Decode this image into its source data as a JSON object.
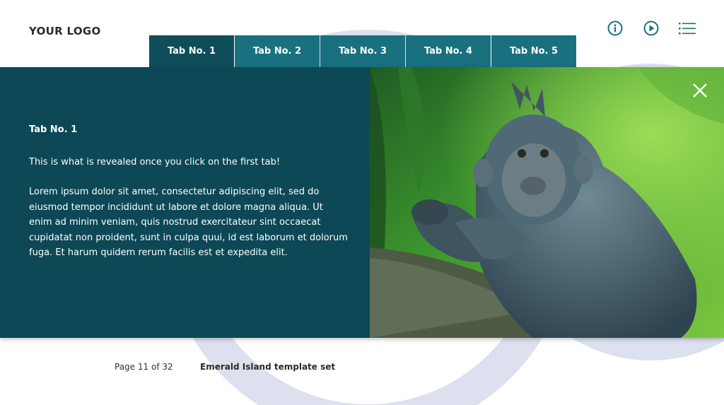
{
  "header": {
    "logo": "YOUR LOGO",
    "icons": [
      "info-icon",
      "play-icon",
      "menu-icon"
    ]
  },
  "tabs": [
    {
      "label": "Tab No. 1",
      "active": true
    },
    {
      "label": "Tab No. 2",
      "active": false
    },
    {
      "label": "Tab No. 3",
      "active": false
    },
    {
      "label": "Tab No. 4",
      "active": false
    },
    {
      "label": "Tab No. 5",
      "active": false
    }
  ],
  "content": {
    "title": "Tab No. 1",
    "intro": "This is what is revealed once you click on the first tab!",
    "body": "Lorem ipsum dolor sit amet, consectetur adipiscing elit, sed do eiusmod tempor incididunt ut labore et dolore magna aliqua. Ut enim ad minim veniam, quis nostrud exercitateur sint occaecat cupidatat non proident, sunt in culpa quui, id est laborum et dolorum fuga. Et harum quidem rerum facilis est et expedita elit."
  },
  "footer": {
    "page": "Page 11 of 32",
    "set_name": "Emerald Island template set"
  },
  "colors": {
    "panel": "#0c4856",
    "tab": "#19707f",
    "tab_active": "#0f4d5a",
    "icon": "#1a7080",
    "arc": "#dde0ee"
  }
}
